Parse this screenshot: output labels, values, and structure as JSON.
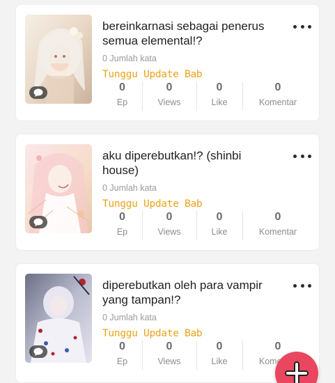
{
  "theme": {
    "accent": "#e8475f",
    "status_color": "#e8a317"
  },
  "novels": [
    {
      "title": "bereinkarnasi sebagai penerus semua elemental!?",
      "word_count": "0 Jumlah kata",
      "status": "Tunggu Update Bab",
      "stats": {
        "ep": "0",
        "ep_label": "Ep",
        "views": "0",
        "views_label": "Views",
        "like": "0",
        "like_label": "Like",
        "komentar": "0",
        "komentar_label": "Komentar"
      }
    },
    {
      "title": "aku diperebutkan!? (shinbi house)",
      "word_count": "0 Jumlah kata",
      "status": "Tunggu Update Bab",
      "stats": {
        "ep": "0",
        "ep_label": "Ep",
        "views": "0",
        "views_label": "Views",
        "like": "0",
        "like_label": "Like",
        "komentar": "0",
        "komentar_label": "Komentar"
      }
    },
    {
      "title": "diperebutkan oleh para vampir yang tampan!?",
      "word_count": "0 Jumlah kata",
      "status": "Tunggu Update Bab",
      "stats": {
        "ep": "0",
        "ep_label": "Ep",
        "views": "0",
        "views_label": "Views",
        "like": "0",
        "like_label": "Like",
        "komentar": "0",
        "komentar_label": "Komentar"
      }
    }
  ],
  "icons": {
    "more": "more-vertical-dots-icon",
    "comment": "comment-bubble-icon",
    "add": "plus-icon"
  }
}
